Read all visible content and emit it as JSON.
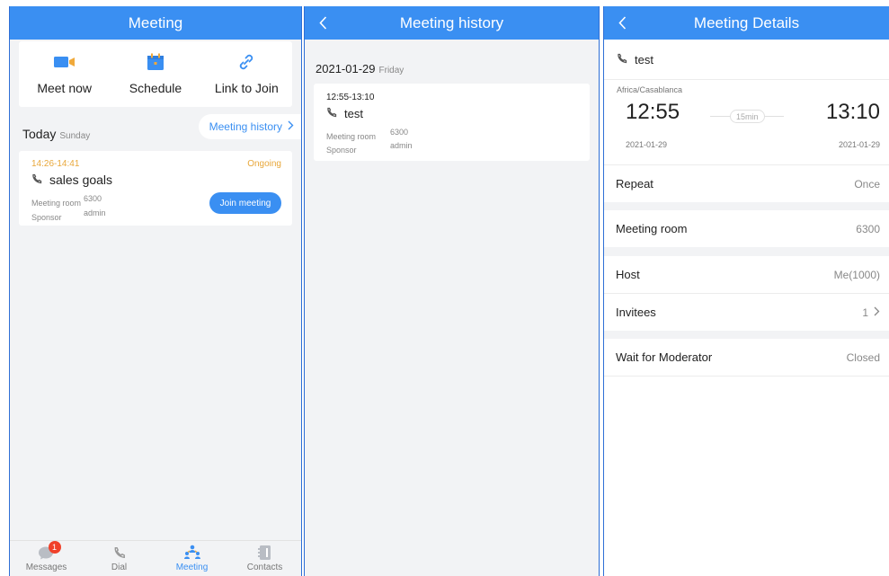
{
  "colors": {
    "accent": "#3a8ff2",
    "ongoing": "#e8a73a",
    "badge": "#f0412a",
    "background": "#f2f3f5"
  },
  "screen1": {
    "title": "Meeting",
    "quick_actions": [
      {
        "label": "Meet now",
        "icon": "video-camera-icon"
      },
      {
        "label": "Schedule",
        "icon": "calendar-icon"
      },
      {
        "label": "Link to Join",
        "icon": "link-icon"
      }
    ],
    "today_label": "Today",
    "today_weekday": "Sunday",
    "history_link": "Meeting history",
    "meeting": {
      "time": "14:26-14:41",
      "status": "Ongoing",
      "title": "sales goals",
      "room_label": "Meeting room",
      "room": "6300",
      "sponsor_label": "Sponsor",
      "sponsor": "admin",
      "join_label": "Join meeting"
    },
    "tabs": [
      {
        "label": "Messages",
        "icon": "messages-icon",
        "badge": "1"
      },
      {
        "label": "Dial",
        "icon": "phone-icon"
      },
      {
        "label": "Meeting",
        "icon": "meeting-icon",
        "active": true
      },
      {
        "label": "Contacts",
        "icon": "contacts-icon"
      }
    ]
  },
  "screen2": {
    "title": "Meeting history",
    "date": "2021-01-29",
    "weekday": "Friday",
    "meeting": {
      "time": "12:55-13:10",
      "title": "test",
      "room_label": "Meeting room",
      "room": "6300",
      "sponsor_label": "Sponsor",
      "sponsor": "admin"
    }
  },
  "screen3": {
    "title": "Meeting Details",
    "meeting_title": "test",
    "timezone": "Africa/Casablanca",
    "start_time": "12:55",
    "end_time": "13:10",
    "duration": "15min",
    "start_date": "2021-01-29",
    "end_date": "2021-01-29",
    "rows": [
      {
        "label": "Repeat",
        "value": "Once"
      },
      {
        "label": "Meeting room",
        "value": "6300"
      },
      {
        "label": "Host",
        "value": "Me(1000)"
      },
      {
        "label": "Invitees",
        "value": "1"
      },
      {
        "label": "Wait for Moderator",
        "value": "Closed"
      }
    ]
  }
}
